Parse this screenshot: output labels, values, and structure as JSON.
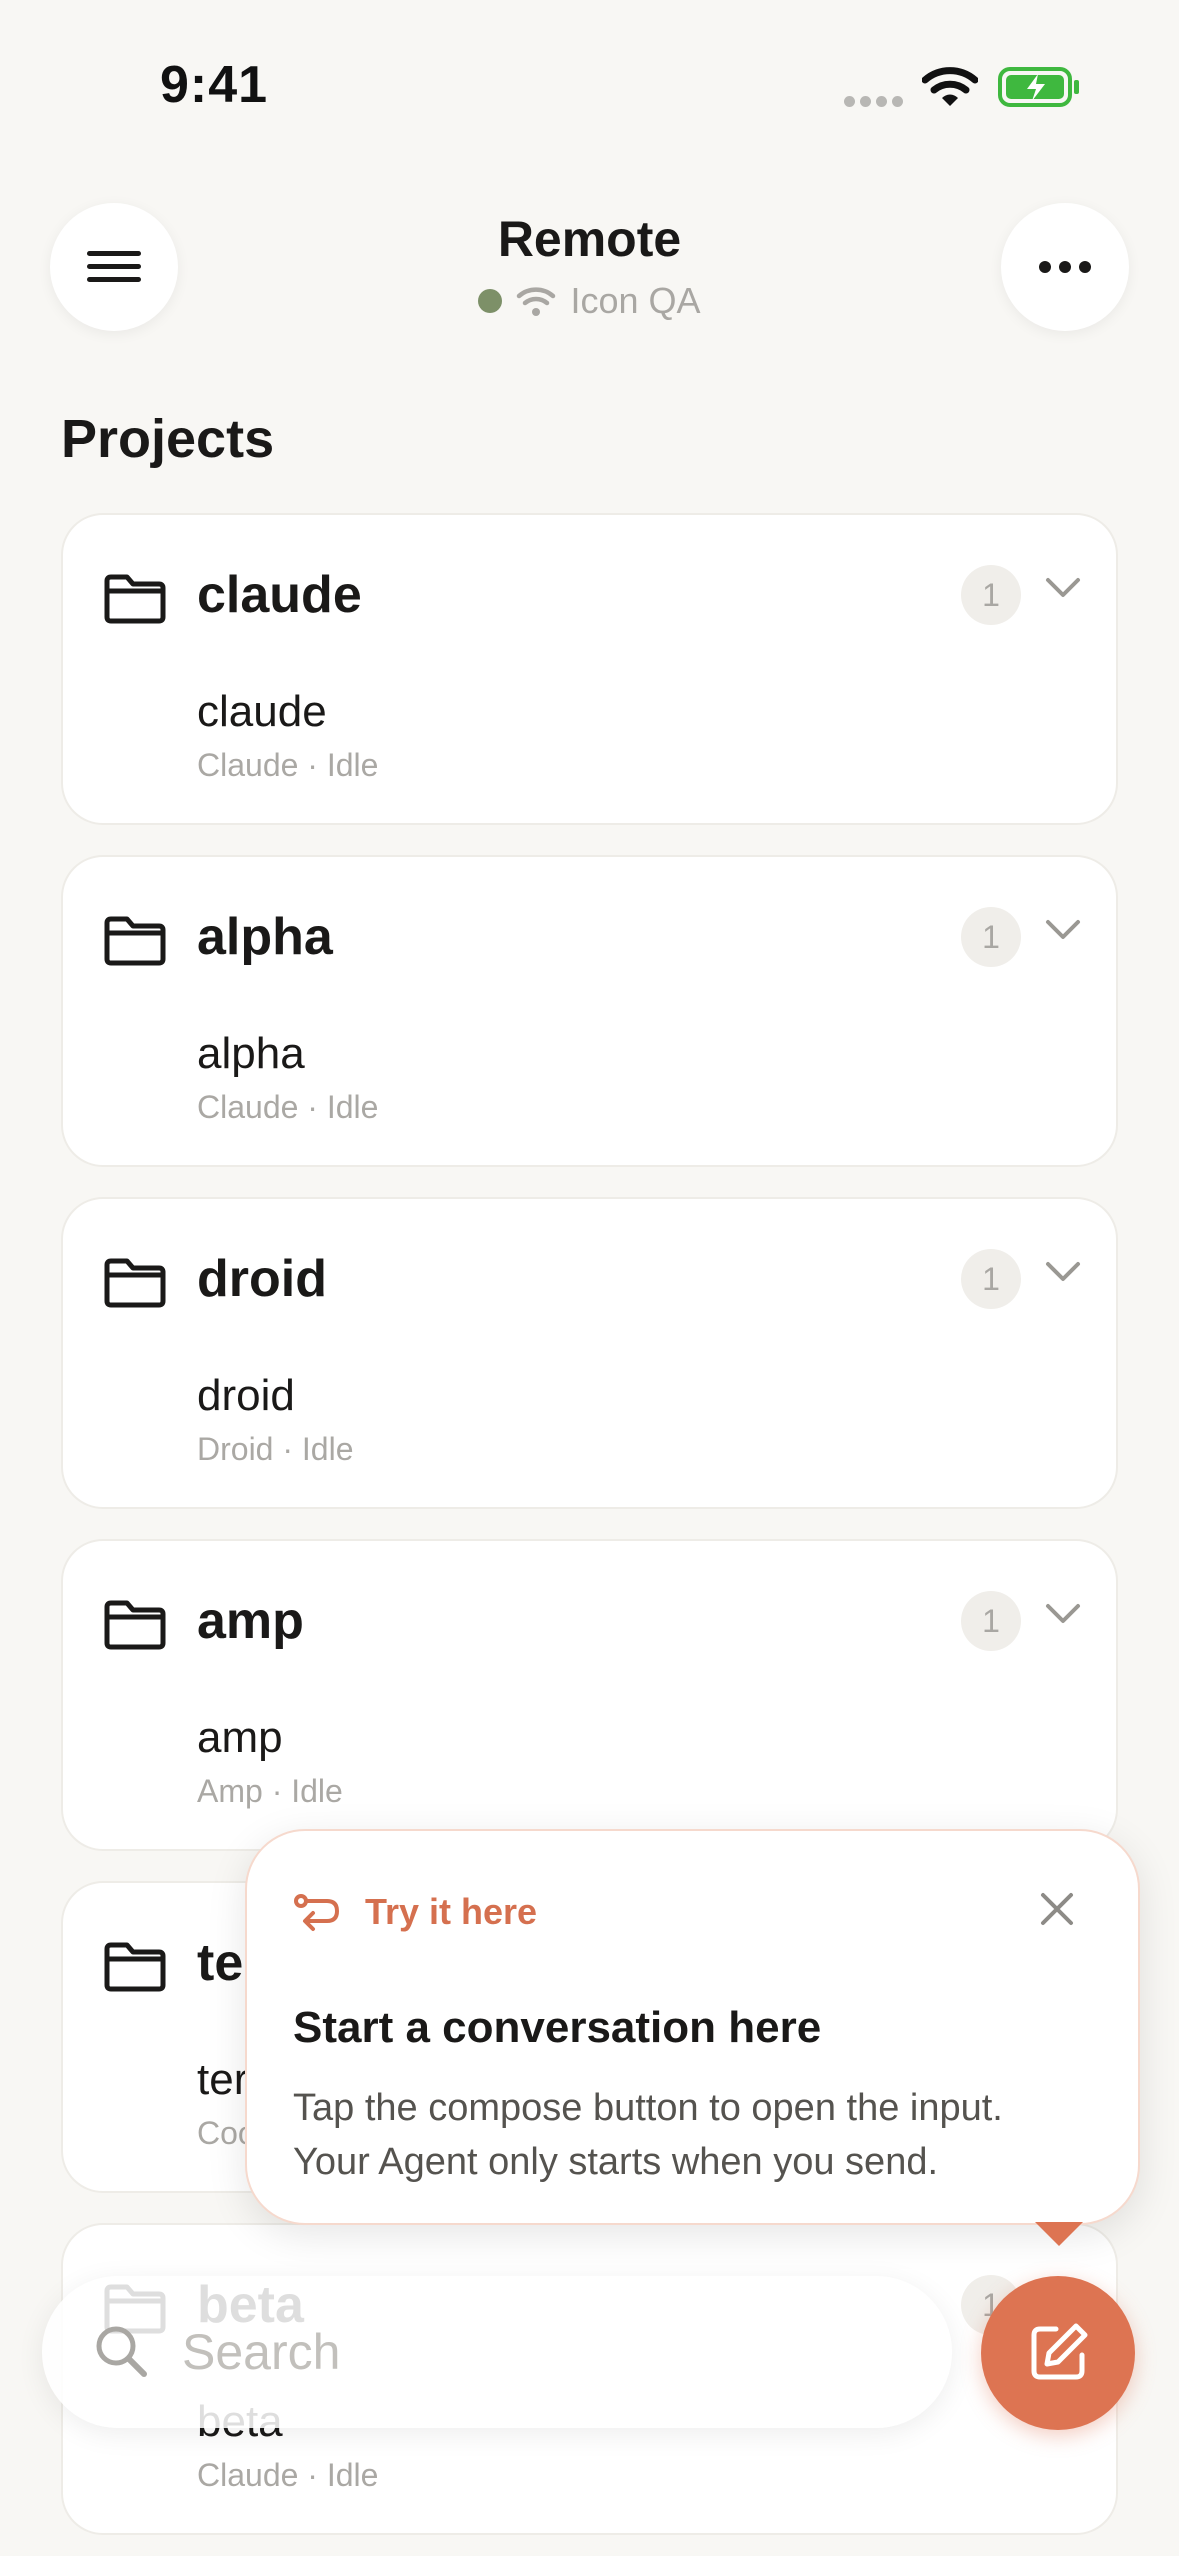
{
  "status_bar": {
    "time": "9:41"
  },
  "header": {
    "title": "Remote",
    "subtitle": "Icon QA",
    "status_color": "#7d9068"
  },
  "section_title": "Projects",
  "projects": [
    {
      "name": "claude",
      "count": "1",
      "session": "claude",
      "meta": "Claude · Idle"
    },
    {
      "name": "alpha",
      "count": "1",
      "session": "alpha",
      "meta": "Claude · Idle"
    },
    {
      "name": "droid",
      "count": "1",
      "session": "droid",
      "meta": "Droid · Idle"
    },
    {
      "name": "amp",
      "count": "1",
      "session": "amp",
      "meta": "Amp · Idle"
    },
    {
      "name": "te",
      "count": "1",
      "session": "ter",
      "meta": "Coo"
    },
    {
      "name": "beta",
      "count": "1",
      "session": "beta",
      "meta": "Claude · Idle"
    }
  ],
  "tooltip": {
    "tag": "Try it here",
    "title": "Start a conversation here",
    "body_line1": "Tap the compose button to open the input.",
    "body_line2": "Your Agent only starts when you send."
  },
  "search": {
    "placeholder": "Search",
    "value": ""
  },
  "colors": {
    "accent": "#dd7452",
    "background": "#f8f7f4",
    "card": "#ffffff"
  },
  "icons": [
    "menu-icon",
    "more-icon",
    "wifi-icon",
    "folder-icon",
    "chevron-down-icon",
    "search-icon",
    "compose-icon",
    "close-icon",
    "route-icon",
    "battery-charging-icon"
  ]
}
